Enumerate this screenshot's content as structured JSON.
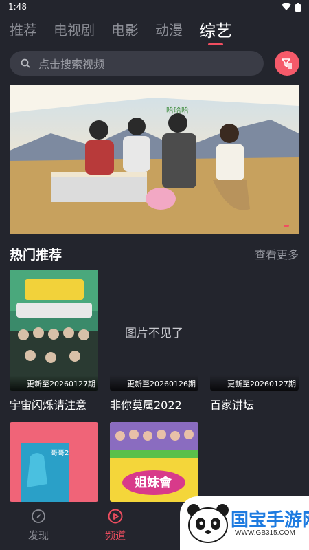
{
  "status_bar": {
    "time": "1:48"
  },
  "tabs": [
    {
      "label": "推荐",
      "active": false
    },
    {
      "label": "电视剧",
      "active": false
    },
    {
      "label": "电影",
      "active": false
    },
    {
      "label": "动漫",
      "active": false
    },
    {
      "label": "综艺",
      "active": true
    }
  ],
  "search": {
    "placeholder": "点击搜索视频",
    "icon": "search-icon",
    "filter_icon": "filter-icon"
  },
  "banner": {
    "image": "variety-show-banner"
  },
  "section": {
    "title": "热门推荐",
    "more": "查看更多"
  },
  "cards": [
    {
      "title": "宇宙闪烁请注意",
      "update": "更新至20260127期",
      "image_state": "poster"
    },
    {
      "title": "非你莫属2022",
      "update": "更新至20260126期",
      "image_state": "missing",
      "missing_text": "图片不见了"
    },
    {
      "title": "百家讲坛",
      "update": "更新至20260127期",
      "image_state": "blank"
    },
    {
      "title": "",
      "update": "",
      "image_state": "poster-2"
    },
    {
      "title": "",
      "update": "",
      "image_state": "poster-3"
    }
  ],
  "bottom_nav": [
    {
      "label": "发现",
      "icon": "compass-icon",
      "active": false
    },
    {
      "label": "频道",
      "icon": "play-icon",
      "active": true
    }
  ],
  "watermark": {
    "text": "国宝手游网",
    "url": "WWW.GB315.COM"
  },
  "colors": {
    "background": "#23252d",
    "accent": "#f04e60",
    "search_bg": "#3a3c46"
  }
}
